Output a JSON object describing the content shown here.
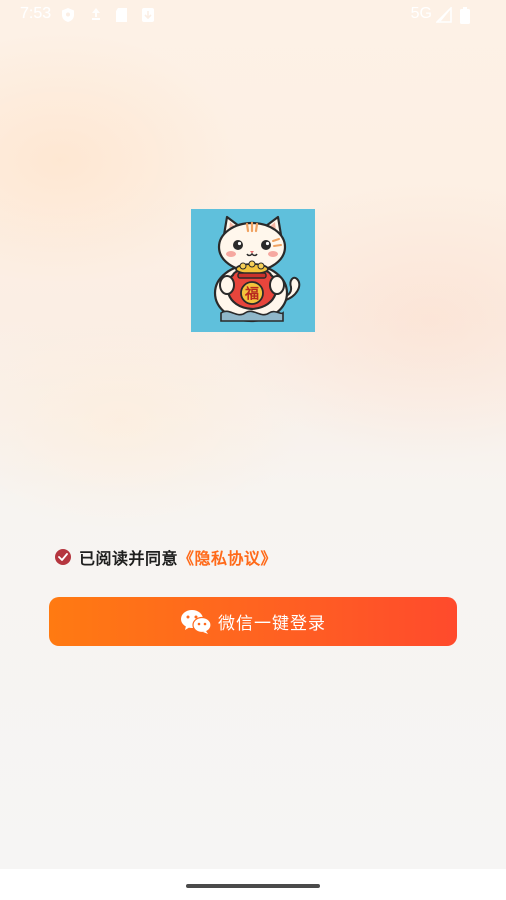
{
  "status_bar": {
    "time": "7:53",
    "network": "5G",
    "icons": [
      "shield-icon",
      "data-saver-icon",
      "sim-card-icon",
      "download-icon",
      "signal-icon",
      "battery-icon"
    ]
  },
  "logo": {
    "icon": "lucky-cat-icon",
    "badge_char": "福",
    "colors": {
      "background": "#5fc0dc",
      "bag": "#e8453c"
    }
  },
  "agreement": {
    "text": "已阅读并同意",
    "link": "《隐私协议》",
    "checked": true,
    "colors": {
      "check": "#b5363f",
      "link": "#ff6a1a"
    }
  },
  "login_button": {
    "label": "微信一键登录",
    "icon": "wechat-icon",
    "colors": {
      "start": "#ff7a12",
      "end": "#ff4a2c"
    }
  }
}
